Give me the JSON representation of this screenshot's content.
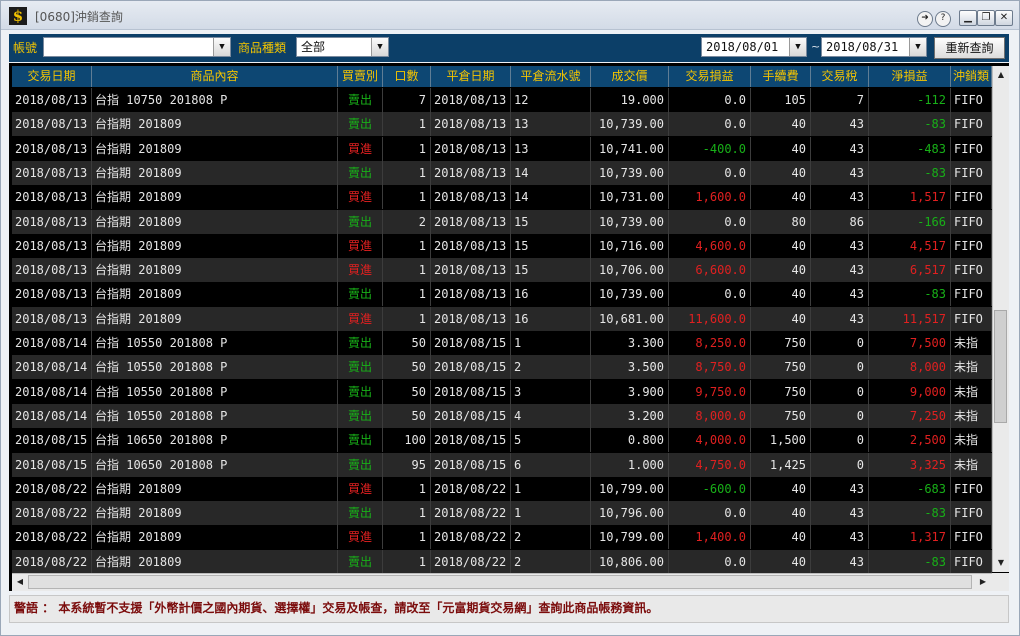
{
  "window": {
    "title": "[0680]沖銷查詢",
    "app_icon": "$"
  },
  "toolbar": {
    "account_label": "帳號",
    "account_value": "",
    "product_type_label": "商品種類",
    "product_type_value": "全部",
    "date_from": "2018/08/01",
    "date_sep": "~",
    "date_to": "2018/08/31",
    "requery_label": "重新查詢"
  },
  "table": {
    "headers": [
      "交易日期",
      "商品內容",
      "買賣別",
      "口數",
      "平倉日期",
      "平倉流水號",
      "成交價",
      "交易損益",
      "手續費",
      "交易稅",
      "淨損益",
      "沖銷類"
    ],
    "rows": [
      [
        "2018/08/13",
        "台指 10750 201808 P",
        "賣出",
        "7",
        "2018/08/13",
        "12",
        "19.000",
        "0.0",
        "105",
        "7",
        "-112",
        "FIFO"
      ],
      [
        "2018/08/13",
        "台指期 201809",
        "賣出",
        "1",
        "2018/08/13",
        "13",
        "10,739.00",
        "0.0",
        "40",
        "43",
        "-83",
        "FIFO"
      ],
      [
        "2018/08/13",
        "台指期 201809",
        "買進",
        "1",
        "2018/08/13",
        "13",
        "10,741.00",
        "-400.0",
        "40",
        "43",
        "-483",
        "FIFO"
      ],
      [
        "2018/08/13",
        "台指期 201809",
        "賣出",
        "1",
        "2018/08/13",
        "14",
        "10,739.00",
        "0.0",
        "40",
        "43",
        "-83",
        "FIFO"
      ],
      [
        "2018/08/13",
        "台指期 201809",
        "買進",
        "1",
        "2018/08/13",
        "14",
        "10,731.00",
        "1,600.0",
        "40",
        "43",
        "1,517",
        "FIFO"
      ],
      [
        "2018/08/13",
        "台指期 201809",
        "賣出",
        "2",
        "2018/08/13",
        "15",
        "10,739.00",
        "0.0",
        "80",
        "86",
        "-166",
        "FIFO"
      ],
      [
        "2018/08/13",
        "台指期 201809",
        "買進",
        "1",
        "2018/08/13",
        "15",
        "10,716.00",
        "4,600.0",
        "40",
        "43",
        "4,517",
        "FIFO"
      ],
      [
        "2018/08/13",
        "台指期 201809",
        "買進",
        "1",
        "2018/08/13",
        "15",
        "10,706.00",
        "6,600.0",
        "40",
        "43",
        "6,517",
        "FIFO"
      ],
      [
        "2018/08/13",
        "台指期 201809",
        "賣出",
        "1",
        "2018/08/13",
        "16",
        "10,739.00",
        "0.0",
        "40",
        "43",
        "-83",
        "FIFO"
      ],
      [
        "2018/08/13",
        "台指期 201809",
        "買進",
        "1",
        "2018/08/13",
        "16",
        "10,681.00",
        "11,600.0",
        "40",
        "43",
        "11,517",
        "FIFO"
      ],
      [
        "2018/08/14",
        "台指 10550 201808 P",
        "賣出",
        "50",
        "2018/08/15",
        "1",
        "3.300",
        "8,250.0",
        "750",
        "0",
        "7,500",
        "未指"
      ],
      [
        "2018/08/14",
        "台指 10550 201808 P",
        "賣出",
        "50",
        "2018/08/15",
        "2",
        "3.500",
        "8,750.0",
        "750",
        "0",
        "8,000",
        "未指"
      ],
      [
        "2018/08/14",
        "台指 10550 201808 P",
        "賣出",
        "50",
        "2018/08/15",
        "3",
        "3.900",
        "9,750.0",
        "750",
        "0",
        "9,000",
        "未指"
      ],
      [
        "2018/08/14",
        "台指 10550 201808 P",
        "賣出",
        "50",
        "2018/08/15",
        "4",
        "3.200",
        "8,000.0",
        "750",
        "0",
        "7,250",
        "未指"
      ],
      [
        "2018/08/15",
        "台指 10650 201808 P",
        "賣出",
        "100",
        "2018/08/15",
        "5",
        "0.800",
        "4,000.0",
        "1,500",
        "0",
        "2,500",
        "未指"
      ],
      [
        "2018/08/15",
        "台指 10650 201808 P",
        "賣出",
        "95",
        "2018/08/15",
        "6",
        "1.000",
        "4,750.0",
        "1,425",
        "0",
        "3,325",
        "未指"
      ],
      [
        "2018/08/22",
        "台指期 201809",
        "買進",
        "1",
        "2018/08/22",
        "1",
        "10,799.00",
        "-600.0",
        "40",
        "43",
        "-683",
        "FIFO"
      ],
      [
        "2018/08/22",
        "台指期 201809",
        "賣出",
        "1",
        "2018/08/22",
        "1",
        "10,796.00",
        "0.0",
        "40",
        "43",
        "-83",
        "FIFO"
      ],
      [
        "2018/08/22",
        "台指期 201809",
        "買進",
        "1",
        "2018/08/22",
        "2",
        "10,799.00",
        "1,400.0",
        "40",
        "43",
        "1,317",
        "FIFO"
      ],
      [
        "2018/08/22",
        "台指期 201809",
        "賣出",
        "1",
        "2018/08/22",
        "2",
        "10,806.00",
        "0.0",
        "40",
        "43",
        "-83",
        "FIFO"
      ]
    ]
  },
  "warning_text": "警語 ： 本系統暫不支援「外幣計價之國內期貨、選擇權」交易及帳查，請改至「元富期貨交易網」查詢此商品帳務資訊。",
  "colors": {
    "header_bg": "#0d4773",
    "header_text": "#f4c400",
    "buy": "#e02020",
    "sell": "#18b018",
    "gain": "#e02020",
    "loss": "#18b018"
  },
  "icons": [
    "dollar-app-icon",
    "restore-pin-icon",
    "help-icon",
    "minimize-icon",
    "maximize-icon",
    "close-icon",
    "dropdown-arrow-icon",
    "scroll-up-arrow-icon",
    "scroll-down-arrow-icon",
    "scroll-left-arrow-icon",
    "scroll-right-arrow-icon"
  ]
}
